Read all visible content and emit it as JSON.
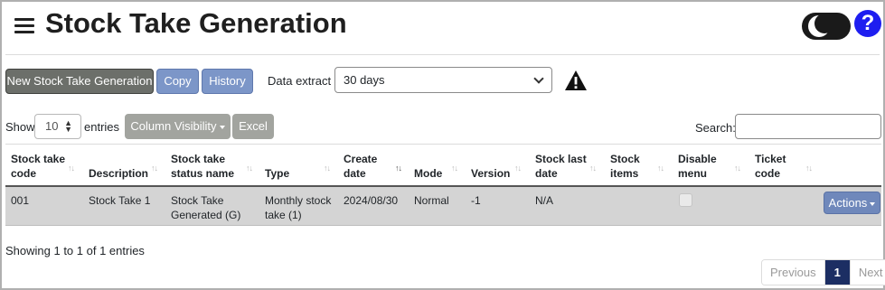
{
  "header": {
    "title": "Stock Take Generation",
    "help_label": "?"
  },
  "toolbar": {
    "new_label": "New Stock Take Generation",
    "copy_label": "Copy",
    "history_label": "History",
    "extract_label": "Data extract",
    "extract_value": "30 days"
  },
  "controls": {
    "show_label": "Show",
    "page_length": "10",
    "entries_label": "entries",
    "column_visibility_label": "Column Visibility",
    "excel_label": "Excel",
    "search_label": "Search:",
    "search_value": ""
  },
  "table": {
    "columns": [
      {
        "line1": "Stock take",
        "line2": "code",
        "sort": "none"
      },
      {
        "line1": "",
        "line2": "Description",
        "sort": "none"
      },
      {
        "line1": "Stock take",
        "line2": "status name",
        "sort": "none"
      },
      {
        "line1": "",
        "line2": "Type",
        "sort": "none"
      },
      {
        "line1": "Create",
        "line2": "date",
        "sort": "desc"
      },
      {
        "line1": "",
        "line2": "Mode",
        "sort": "none"
      },
      {
        "line1": "",
        "line2": "Version",
        "sort": "none"
      },
      {
        "line1": "Stock last",
        "line2": "date",
        "sort": "none"
      },
      {
        "line1": "Stock",
        "line2": "items",
        "sort": "none"
      },
      {
        "line1": "Disable",
        "line2": "menu",
        "sort": "none"
      },
      {
        "line1": "Ticket",
        "line2": "code",
        "sort": "none"
      }
    ],
    "rows": [
      {
        "code": "001",
        "description": "Stock Take 1",
        "status_line1": "Stock Take",
        "status_line2": "Generated (G)",
        "type_line1": "Monthly stock",
        "type_line2": "take (1)",
        "create_date": "2024/08/30",
        "mode": "Normal",
        "version": "-1",
        "stock_last_date": "N/A",
        "stock_items": "",
        "disable_menu": false,
        "ticket_code": "",
        "actions_label": "Actions"
      }
    ]
  },
  "footer": {
    "info": "Showing 1 to 1 of 1 entries",
    "previous_label": "Previous",
    "current_page": "1",
    "next_label": "Next"
  },
  "colors": {
    "primary_dark": "#1c2e63",
    "button_blue": "#7c96c8",
    "button_dark": "#6c6f6a",
    "row_bg": "#d4d4d4",
    "help_blue": "#1e1ef0"
  },
  "icons": [
    "menu-icon",
    "dark-mode-toggle",
    "help-icon",
    "warning-icon",
    "chevron-down-icon",
    "sort-icon",
    "caret-down-icon"
  ]
}
